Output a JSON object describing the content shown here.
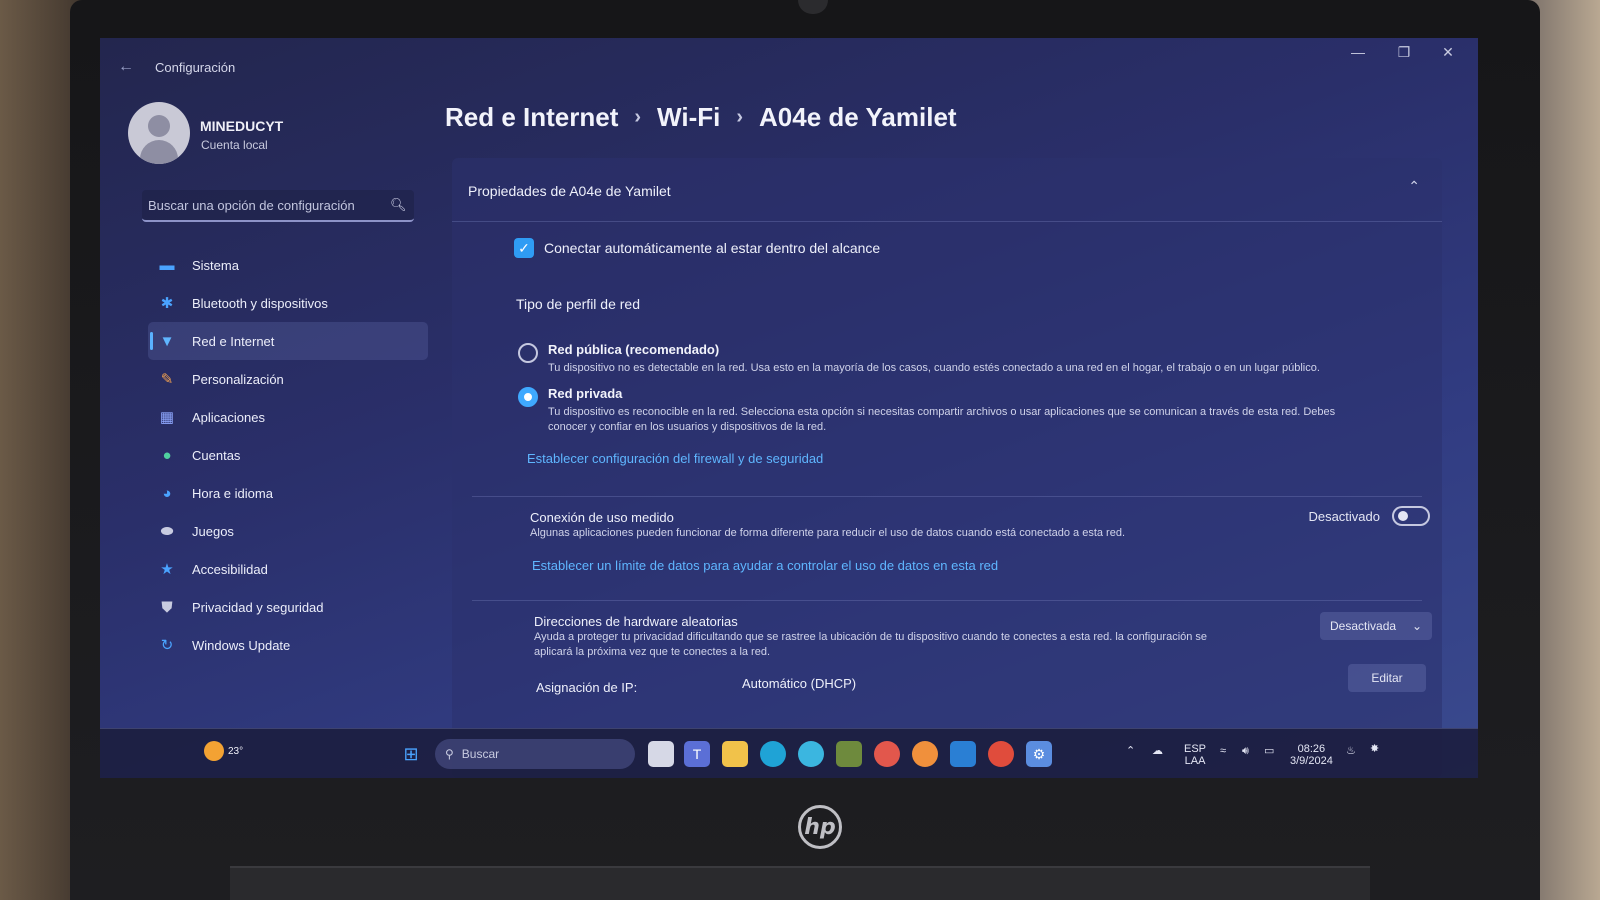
{
  "window": {
    "title": "Configuración",
    "minimize_glyph": "—",
    "restore_glyph": "❐",
    "close_glyph": "✕",
    "back_glyph": "←"
  },
  "profile": {
    "name": "MINEDUCYT",
    "account_type": "Cuenta local"
  },
  "search": {
    "placeholder": "Buscar una opción de configuración"
  },
  "sidebar": {
    "items": [
      {
        "label": "Sistema",
        "icon": "monitor-icon",
        "color": "#4aa3ff"
      },
      {
        "label": "Bluetooth y dispositivos",
        "icon": "bluetooth-icon",
        "color": "#4aa3ff"
      },
      {
        "label": "Red e Internet",
        "icon": "wifi-icon",
        "color": "#5fb6ff",
        "active": true
      },
      {
        "label": "Personalización",
        "icon": "brush-icon",
        "color": "#f0a050"
      },
      {
        "label": "Aplicaciones",
        "icon": "apps-icon",
        "color": "#8fa8ff"
      },
      {
        "label": "Cuentas",
        "icon": "person-icon",
        "color": "#4fd1a0"
      },
      {
        "label": "Hora e idioma",
        "icon": "globe-clock-icon",
        "color": "#4aa3ff"
      },
      {
        "label": "Juegos",
        "icon": "gamepad-icon",
        "color": "#c8cbe0"
      },
      {
        "label": "Accesibilidad",
        "icon": "accessibility-icon",
        "color": "#4aa3ff"
      },
      {
        "label": "Privacidad y seguridad",
        "icon": "shield-icon",
        "color": "#c8cbe0"
      },
      {
        "label": "Windows Update",
        "icon": "update-icon",
        "color": "#4aa3ff"
      }
    ]
  },
  "breadcrumb": {
    "level1": "Red e Internet",
    "level2": "Wi-Fi",
    "level3": "A04e de Yamilet",
    "separator": "›"
  },
  "properties": {
    "header": "Propiedades de A04e de Yamilet",
    "auto_connect": {
      "label": "Conectar automáticamente al estar dentro del alcance",
      "checked": true
    },
    "profile_type_label": "Tipo de perfil de red",
    "public": {
      "title": "Red pública (recomendado)",
      "description": "Tu dispositivo no es detectable en la red. Usa esto en la mayoría de los casos, cuando estés conectado a una red en el hogar, el trabajo o en un lugar público.",
      "selected": false
    },
    "private": {
      "title": "Red privada",
      "description": "Tu dispositivo es reconocible en la red. Selecciona esta opción si necesitas compartir archivos o usar aplicaciones que se comunican a través de esta red. Debes conocer y confiar en los usuarios y dispositivos de la red.",
      "selected": true
    },
    "firewall_link": "Establecer configuración del firewall y de seguridad",
    "metered": {
      "title": "Conexión de uso medido",
      "description": "Algunas aplicaciones pueden funcionar de forma diferente para reducir el uso de datos cuando está conectado a esta red.",
      "state_label": "Desactivado",
      "on": false
    },
    "data_limit_link": "Establecer un límite de datos para ayudar a controlar el uso de datos en esta red",
    "random_hw": {
      "title": "Direcciones de hardware aleatorias",
      "description": "Ayuda a proteger tu privacidad dificultando que se rastree la ubicación de tu dispositivo cuando te conectes a esta red. la configuración se aplicará la próxima vez que te conectes a la red.",
      "value": "Desactivada"
    },
    "ip": {
      "label": "Asignación de IP:",
      "value": "Automático (DHCP)",
      "edit_label": "Editar"
    }
  },
  "taskbar": {
    "weather": "23°",
    "search_label": "Buscar",
    "language": "ESP",
    "layout": "LAA",
    "time": "08:26",
    "date": "3/9/2024"
  },
  "device": {
    "brand": "hp"
  }
}
